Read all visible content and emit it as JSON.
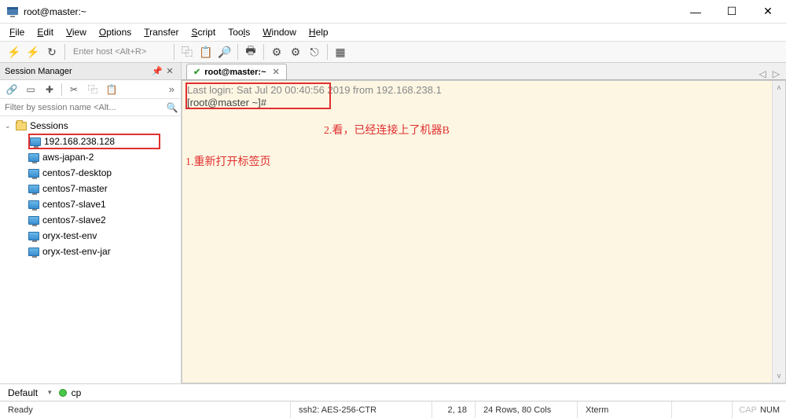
{
  "window": {
    "title": "root@master:~",
    "min": "—",
    "max": "☐",
    "close": "✕"
  },
  "menubar": [
    "File",
    "Edit",
    "View",
    "Options",
    "Transfer",
    "Script",
    "Tools",
    "Window",
    "Help"
  ],
  "toolbar": {
    "host_placeholder": "Enter host <Alt+R>"
  },
  "session_manager": {
    "title": "Session Manager",
    "filter_placeholder": "Filter by session name <Alt...",
    "root": "Sessions",
    "items": [
      "192.168.238.128",
      "aws-japan-2",
      "centos7-desktop",
      "centos7-master",
      "centos7-slave1",
      "centos7-slave2",
      "oryx-test-env",
      "oryx-test-env-jar"
    ]
  },
  "tab": {
    "label": "root@master:~"
  },
  "terminal": {
    "last_login": "Last login: Sat Jul 20 00:40:56 2019 from 192.168.238.1",
    "prompt": "[root@master ~]#",
    "annotation1": "1.重新打开标签页",
    "annotation2": "2.看，已经连接上了机器B"
  },
  "bottombar": {
    "profile": "Default",
    "status": "cp"
  },
  "statusbar": {
    "ready": "Ready",
    "proto": "ssh2: AES-256-CTR",
    "pos": "2,  18",
    "dims": "24 Rows, 80 Cols",
    "term": "Xterm",
    "cap": "CAP",
    "num": "NUM"
  }
}
